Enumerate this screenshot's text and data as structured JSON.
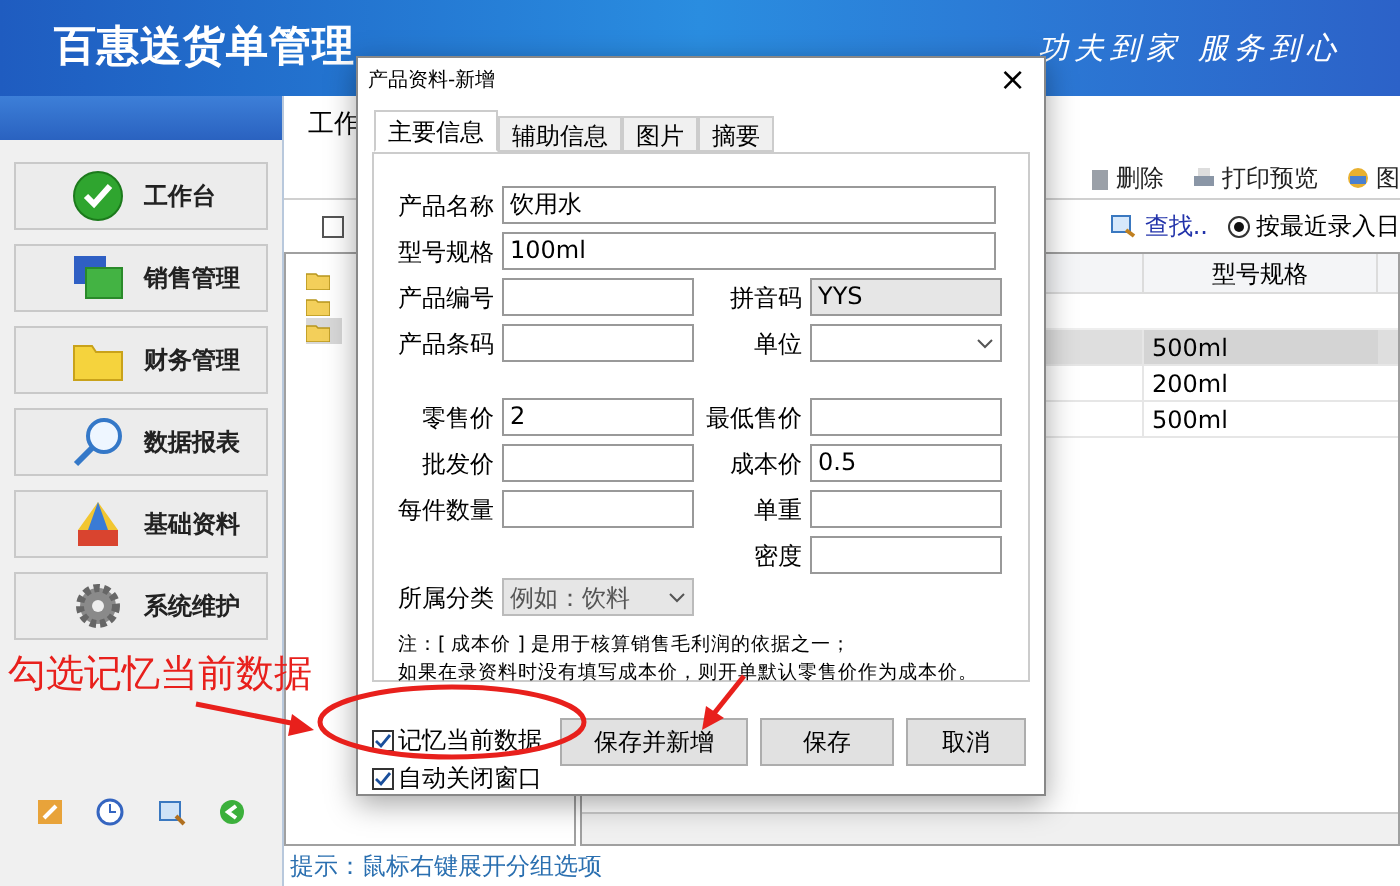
{
  "header": {
    "title": "百惠送货单管理",
    "slogan": "功夫到家 服务到心"
  },
  "sidebar": {
    "items": [
      {
        "label": "工作台"
      },
      {
        "label": "销售管理"
      },
      {
        "label": "财务管理"
      },
      {
        "label": "数据报表"
      },
      {
        "label": "基础资料"
      },
      {
        "label": "系统维护"
      }
    ]
  },
  "main_tab": "工作",
  "toolbar": [
    "删除",
    "打印预览",
    "图"
  ],
  "filter_checkbox": {
    "checked": false
  },
  "tree": [
    {
      "selected": false
    },
    {
      "selected": false
    },
    {
      "selected": true
    }
  ],
  "find_link": "查找..",
  "sort_radio": {
    "label": "按最近录入日",
    "selected": true
  },
  "grid": {
    "column": "型号规格",
    "rows": [
      {
        "spec": "500ml",
        "selected": true
      },
      {
        "spec": "200ml",
        "selected": false
      },
      {
        "spec": "500ml",
        "selected": false
      }
    ]
  },
  "status_bar": "提示：鼠标右键展开分组选项",
  "dialog": {
    "title": "产品资料-新增",
    "close": "×",
    "tabs": [
      {
        "label": "主要信息",
        "selected": true
      },
      {
        "label": "辅助信息",
        "selected": false
      },
      {
        "label": "图片",
        "selected": false
      },
      {
        "label": "摘要",
        "selected": false
      }
    ],
    "wide_fields": [
      {
        "label": "产品名称",
        "value": "饮用水"
      },
      {
        "label": "型号规格",
        "value": "100ml"
      }
    ],
    "left_fields": [
      {
        "label": "产品编号",
        "kind": "text"
      },
      {
        "label": "产品条码",
        "kind": "text"
      },
      {
        "kind": "gap"
      },
      {
        "label": "零售价",
        "value": "2",
        "kind": "text"
      },
      {
        "label": "批发价",
        "kind": "text"
      },
      {
        "label": "每件数量",
        "kind": "text"
      }
    ],
    "right_fields": [
      {
        "label": "拼音码",
        "value": "YYS",
        "kind": "readonly"
      },
      {
        "label": "单位",
        "kind": "select"
      },
      {
        "kind": "gap"
      },
      {
        "label": "最低售价",
        "kind": "text"
      },
      {
        "label": "成本价",
        "value": "0.5",
        "kind": "text"
      },
      {
        "label": "单重",
        "kind": "text"
      },
      {
        "label": "密度",
        "kind": "text"
      }
    ],
    "category": {
      "label": "所属分类",
      "placeholder": "例如：饮料"
    },
    "note": [
      "注：[ 成本价 ] 是用于核算销售毛利润的依据之一；",
      "如果在录资料时没有填写成本价，则开单默认零售价作为成本价。"
    ],
    "options": [
      {
        "label": "记忆当前数据",
        "checked": true
      },
      {
        "label": "自动关闭窗口",
        "checked": true
      }
    ],
    "buttons": [
      "保存并新增",
      "保存",
      "取消"
    ]
  },
  "annotation": "勾选记忆当前数据"
}
